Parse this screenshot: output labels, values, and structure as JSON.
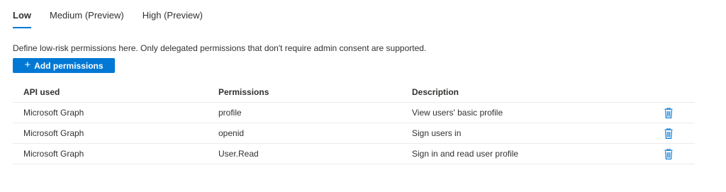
{
  "tabs": [
    {
      "label": "Low",
      "active": true
    },
    {
      "label": "Medium (Preview)",
      "active": false
    },
    {
      "label": "High (Preview)",
      "active": false
    }
  ],
  "description": "Define low-risk permissions here. Only delegated permissions that don't require admin consent are supported.",
  "add_button": {
    "icon": "plus-icon",
    "label": "Add permissions"
  },
  "table": {
    "columns": [
      "API used",
      "Permissions",
      "Description"
    ],
    "rows": [
      {
        "api": "Microsoft Graph",
        "permission": "profile",
        "description": "View users' basic profile"
      },
      {
        "api": "Microsoft Graph",
        "permission": "openid",
        "description": "Sign users in"
      },
      {
        "api": "Microsoft Graph",
        "permission": "User.Read",
        "description": "Sign in and read user profile"
      }
    ],
    "row_action_icon": "trash-icon"
  },
  "colors": {
    "accent": "#0078d4",
    "text": "#323130",
    "divider": "#edebe9"
  }
}
